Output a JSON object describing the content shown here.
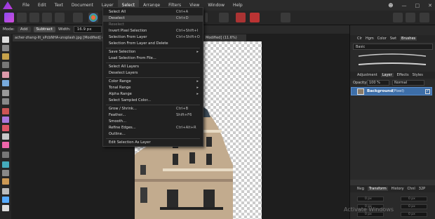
{
  "menubar": {
    "items": [
      "File",
      "Edit",
      "Text",
      "Document",
      "Layer",
      "Select",
      "Arrange",
      "Filters",
      "View",
      "Window",
      "Help"
    ],
    "active_index": 5
  },
  "context": {
    "mode_label": "Mode:",
    "add_label": "Add",
    "subtract_label": "Subtract",
    "width_label": "Width:",
    "width_value": "16.9 px"
  },
  "document": {
    "tab_title": "acher-zhang-llt_sPcbNHA-unsplash.jpg [Modified] (14.8",
    "tab_title_right": "Modified] (11.6%)"
  },
  "select_menu": {
    "items": [
      {
        "label": "Select All",
        "shortcut": "Ctrl+A"
      },
      {
        "label": "Deselect",
        "shortcut": "Ctrl+D",
        "highlight": true
      },
      {
        "label": "Reselect",
        "disabled": true
      },
      {
        "label": "Invert Pixel Selection",
        "shortcut": "Ctrl+Shift+I"
      },
      {
        "label": "Selection From Layer",
        "shortcut": "Ctrl+Shift+O"
      },
      {
        "label": "Selection From Layer and Delete"
      },
      {
        "label": "Save Selection",
        "submenu": true
      },
      {
        "label": "Load Selection From File..."
      },
      {
        "label": "Select All Layers"
      },
      {
        "label": "Deselect Layers"
      },
      {
        "label": "Color Range",
        "submenu": true
      },
      {
        "label": "Tonal Range",
        "submenu": true
      },
      {
        "label": "Alpha Range",
        "submenu": true
      },
      {
        "label": "Select Sampled Color..."
      },
      {
        "label": "Grow / Shrink...",
        "shortcut": "Ctrl+B"
      },
      {
        "label": "Feather...",
        "shortcut": "Shift+F6"
      },
      {
        "label": "Smooth..."
      },
      {
        "label": "Refine Edges...",
        "shortcut": "Ctrl+Alt+R"
      },
      {
        "label": "Outline..."
      },
      {
        "label": "Edit Selection As Layer"
      }
    ]
  },
  "right_panel": {
    "top_tabs": [
      "Clr",
      "Hgm",
      "Color",
      "Swt",
      "Brushes"
    ],
    "brush_category": "Basic",
    "mid_tabs": [
      "Adjustment",
      "Layer",
      "Effects",
      "Styles"
    ],
    "opacity_label": "Opacity:",
    "opacity_value": "100 %",
    "blend_mode": "Normal",
    "layer_name": "Background",
    "layer_kind": "(Pixel)",
    "bottom_tabs": [
      "Nvg",
      "Transform",
      "History",
      "Chnl",
      "32P"
    ],
    "transform_values": [
      "0 px",
      "0 px",
      "0 px",
      "0 px",
      "0 px",
      "0 px"
    ]
  },
  "watermark": "Activate Windows",
  "colors": {
    "accent": "#3d6ea8",
    "menu_bg": "#202020",
    "ui_bg": "#2a2a2a"
  }
}
